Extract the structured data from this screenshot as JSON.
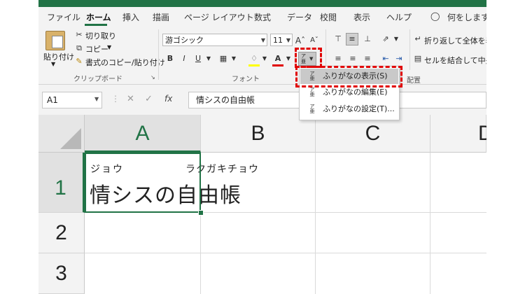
{
  "tabs": [
    "ファイル",
    "ホーム",
    "挿入",
    "描画",
    "ページ レイアウト",
    "数式",
    "データ",
    "校閲",
    "表示",
    "ヘルプ"
  ],
  "tell_me": "何をしますか",
  "clipboard": {
    "paste": "貼り付け",
    "cut": "切り取り",
    "copy": "コピー",
    "format_painter": "書式のコピー/貼り付け",
    "group_label": "クリップボード"
  },
  "font": {
    "name": "游ゴシック",
    "size": "11",
    "group_label": "フォント",
    "bold": "B",
    "italic": "I",
    "underline": "U"
  },
  "alignment": {
    "wrap_text": "折り返して全体を表示",
    "merge_center": "セルを結合して中央揃",
    "group_label": "配置"
  },
  "furigana_menu": {
    "show": "ふりがなの表示(S)",
    "edit": "ふりがなの編集(E)",
    "settings": "ふりがなの設定(T)..."
  },
  "formula_bar": {
    "name_box": "A1",
    "fx": "fx",
    "content": "情シスの自由帳"
  },
  "sheet": {
    "columns": [
      "A",
      "B",
      "C",
      "D"
    ],
    "rows": [
      "1",
      "2",
      "3"
    ],
    "a1_text": "情シスの自由帳",
    "ruby_1": "ジョウ",
    "ruby_2": "ラクガキチョウ"
  },
  "colors": {
    "accent": "#217346",
    "highlight": "#e00000"
  }
}
